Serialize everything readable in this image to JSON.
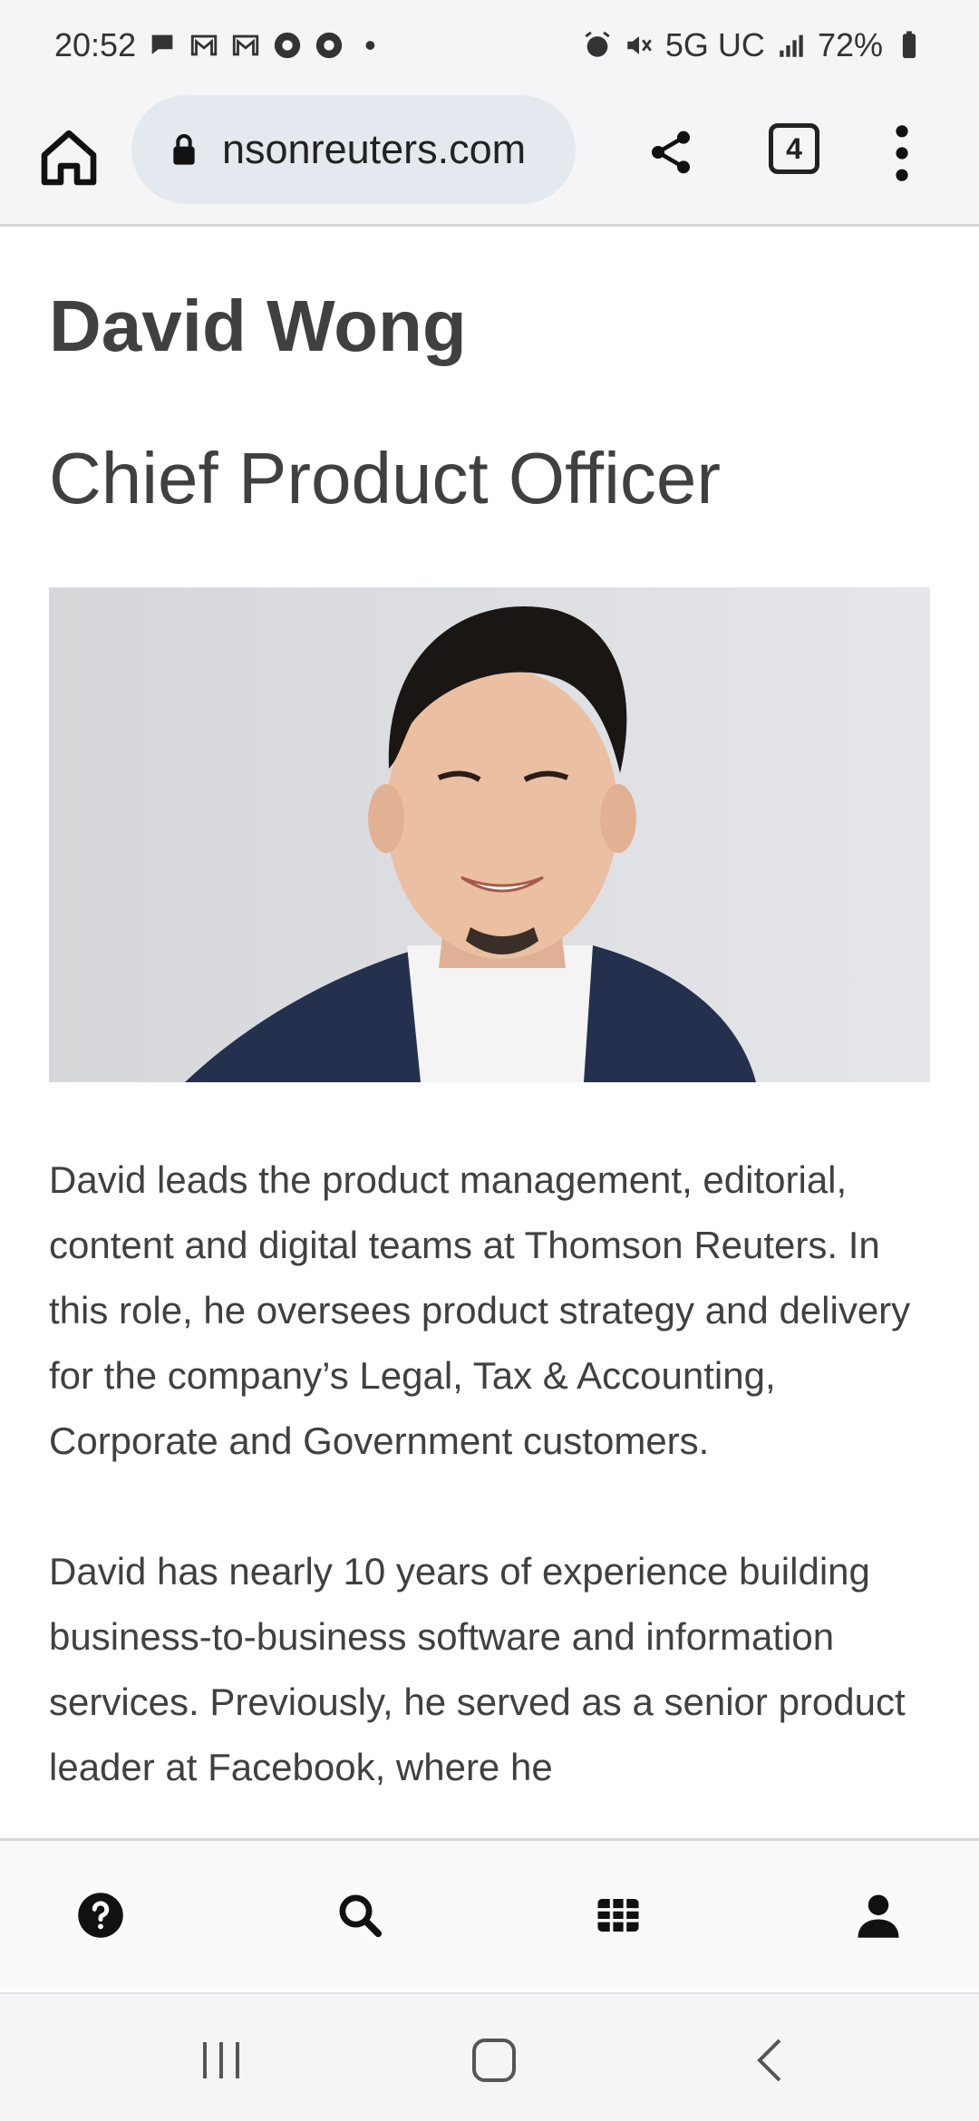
{
  "status_bar": {
    "time": "20:52",
    "network": "5G UC",
    "battery": "72%",
    "notification_icons": [
      "chat-bubble-icon",
      "gmail-icon",
      "gmail-icon",
      "chrome-icon",
      "chrome-icon"
    ],
    "more_dot": "•"
  },
  "browser": {
    "url": "nsonreuters.com",
    "tab_count": "4"
  },
  "page": {
    "name": "David Wong",
    "title": "Chief Product Officer",
    "photo_alt": "David Wong",
    "bio": [
      "David leads the product management, editorial, content and digital teams at Thomson Reuters. In this role, he oversees product strategy and delivery for the company’s Legal, Tax & Accounting, Corporate and Government customers.",
      "David has nearly 10 years of experience building business-to-business software and information services. Previously, he served as a senior product leader at Facebook, where he"
    ]
  },
  "bottom_nav": [
    "help-icon",
    "search-icon",
    "grid-icon",
    "account-icon"
  ],
  "colors": {
    "text": "#404040",
    "chrome_bg": "#f5f5f7",
    "url_pill": "#e4e9ef"
  }
}
